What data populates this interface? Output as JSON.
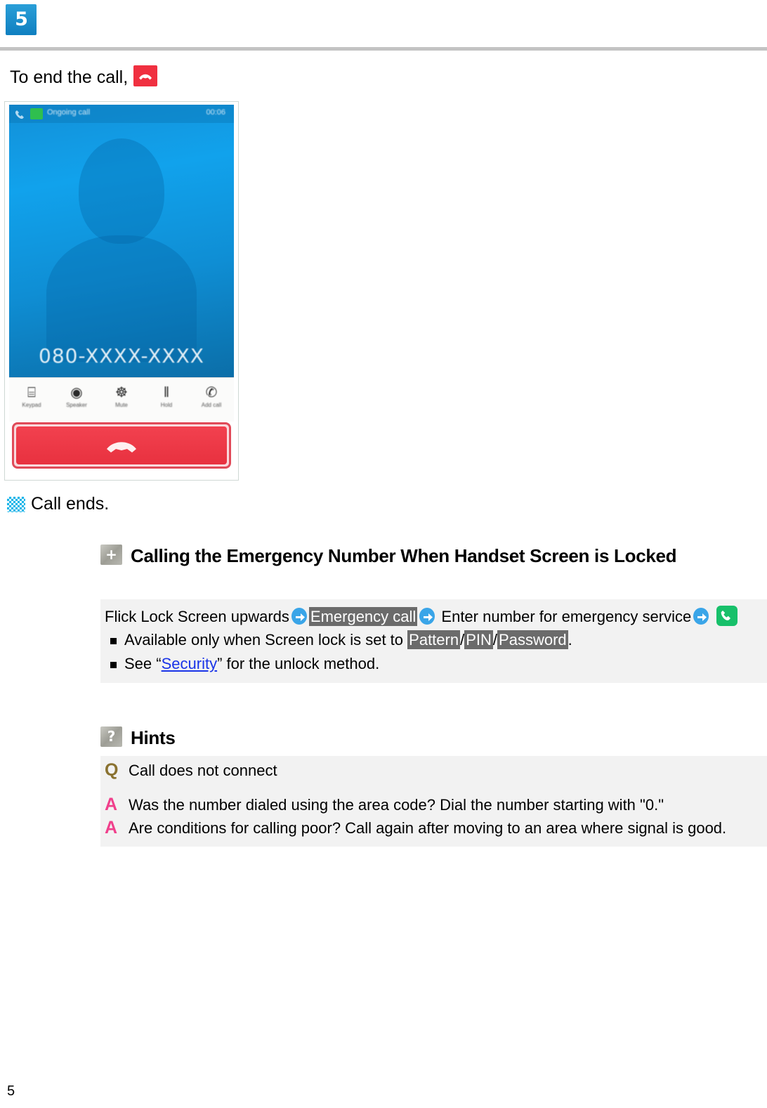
{
  "header": {
    "chapter_number": "5",
    "divider_color": "#c3c3c3"
  },
  "intro": {
    "text": "To end the call,",
    "icon": "end-call-icon",
    "icon_color": "#f03040"
  },
  "phone_screenshot": {
    "status_bar": {
      "call_icon": "call-icon",
      "message_icon": "message-icon",
      "notification_text": "Ongoing call",
      "time": "00:06"
    },
    "avatar": "contact-avatar-silhouette",
    "phone_number": "080-XXXX-XXXX",
    "call_controls": [
      {
        "icon": "keypad-icon",
        "glyph": "⌸",
        "label": "Keypad"
      },
      {
        "icon": "speaker-icon",
        "glyph": "◉",
        "label": "Speaker"
      },
      {
        "icon": "mute-icon",
        "glyph": "☸",
        "label": "Mute"
      },
      {
        "icon": "hold-icon",
        "glyph": "‖",
        "label": "Hold"
      },
      {
        "icon": "add-call-icon",
        "glyph": "✆",
        "label": "Add call"
      }
    ],
    "end_call_button": {
      "icon": "end-call-icon",
      "color": "#e8313f",
      "highlight_border_color": "#e04a58"
    }
  },
  "result": {
    "icon": "checkered-flag-icon",
    "text": "Call ends."
  },
  "emergency_section": {
    "icon": "plus-icon",
    "icon_glyph": "+",
    "title": "Calling the Emergency Number When Handset Screen is Locked",
    "steps": {
      "part1": "Flick Lock Screen upwards",
      "highlight1": "Emergency call",
      "part2": "Enter number for emergency service",
      "call_icon": "phone-call-icon"
    },
    "notes": [
      {
        "prefix": "Available only when Screen lock is set to ",
        "highlights": [
          "Pattern",
          "PIN",
          "Password"
        ],
        "suffix": "."
      },
      {
        "prefix": "See “",
        "link": "Security",
        "suffix": "” for the unlock method."
      }
    ]
  },
  "hints_section": {
    "icon": "question-icon",
    "icon_glyph": "?",
    "title": "Hints",
    "items": [
      {
        "mark": "Q",
        "mark_color": "#8a7230",
        "text": "Call does not connect"
      },
      {
        "mark": "A",
        "mark_color": "#f0408c",
        "text": "Was the number dialed using the area code? Dial the number starting with \"0.\""
      },
      {
        "mark": "A",
        "mark_color": "#f0408c",
        "text": "Are conditions for calling poor? Call again after moving to an area where signal is good."
      }
    ]
  },
  "footer": {
    "page_number": "5"
  }
}
